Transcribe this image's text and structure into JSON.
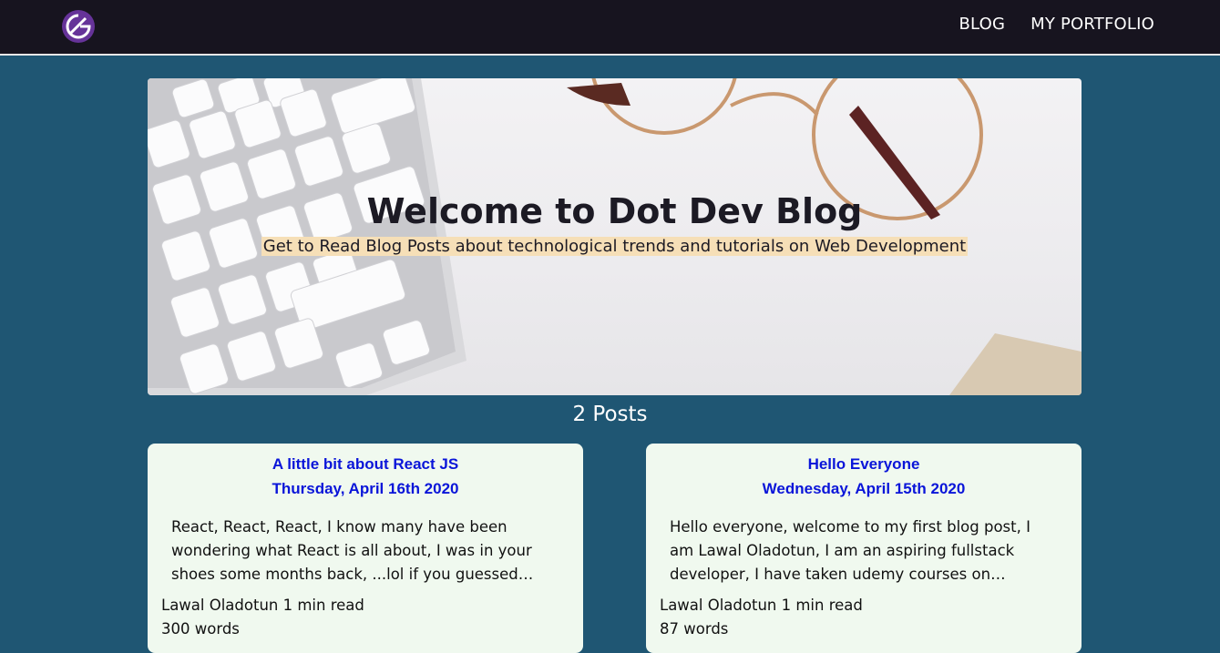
{
  "nav": {
    "logo_icon": "gatsby-logo-icon",
    "links": [
      {
        "label": "BLOG"
      },
      {
        "label": "MY PORTFOLIO"
      }
    ]
  },
  "hero": {
    "title": "Welcome to Dot Dev Blog",
    "subtitle": "Get to Read Blog Posts about technological trends and tutorials on Web Development"
  },
  "post_count": "2 Posts",
  "posts": [
    {
      "title": "A little bit about React JS",
      "date": "Thursday, April 16th 2020",
      "excerpt": "React, React, React, I know many have been wondering what React is all about, I was in your shoes some months back, ...lol if you guessed…",
      "author_read": "Lawal Oladotun 1 min read",
      "words": "300 words"
    },
    {
      "title": "Hello Everyone",
      "date": "Wednesday, April 15th 2020",
      "excerpt": "Hello everyone, welcome to my first blog post, I am Lawal Oladotun, I am an aspiring fullstack developer, I have taken udemy courses on…",
      "author_read": "Lawal Oladotun 1 min read",
      "words": "87 words"
    }
  ],
  "colors": {
    "navbar_bg": "#17141f",
    "page_bg": "#1f5673",
    "card_bg": "#f0f9ef",
    "link_blue": "#0a15d9",
    "subtitle_highlight": "#f6dfb7",
    "logo_purple": "#663399"
  }
}
